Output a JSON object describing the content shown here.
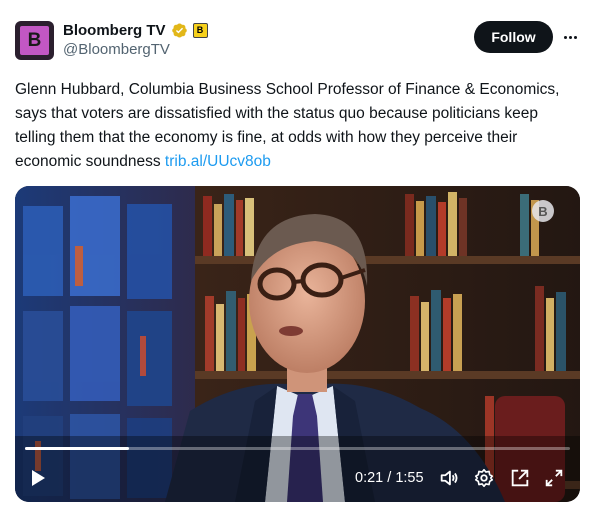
{
  "account": {
    "display_name": "Bloomberg TV",
    "handle": "@BloombergTV",
    "avatar_letter": "B",
    "affiliate_badge_letter": "B"
  },
  "actions": {
    "follow_label": "Follow"
  },
  "tweet": {
    "text": "Glenn Hubbard, Columbia Business School Professor of Finance & Economics, says that voters are dissatisfied with the status quo because politicians keep telling them that the economy is fine, at odds with how they perceive their economic soundness ",
    "link_text": "trib.al/UUcv8ob"
  },
  "video": {
    "watermark_letter": "B",
    "current_time": "0:21",
    "separator": " / ",
    "duration": "1:55",
    "progress_fraction": 0.19
  },
  "icons": {
    "verified": "verified-badge-icon",
    "more": "more-icon",
    "play": "play-icon",
    "volume": "volume-icon",
    "settings": "gear-icon",
    "popout": "popout-icon",
    "fullscreen": "fullscreen-icon"
  },
  "colors": {
    "link": "#1d9bf0",
    "follow_bg": "#0f1419",
    "verified_gold": "#e2b719"
  }
}
